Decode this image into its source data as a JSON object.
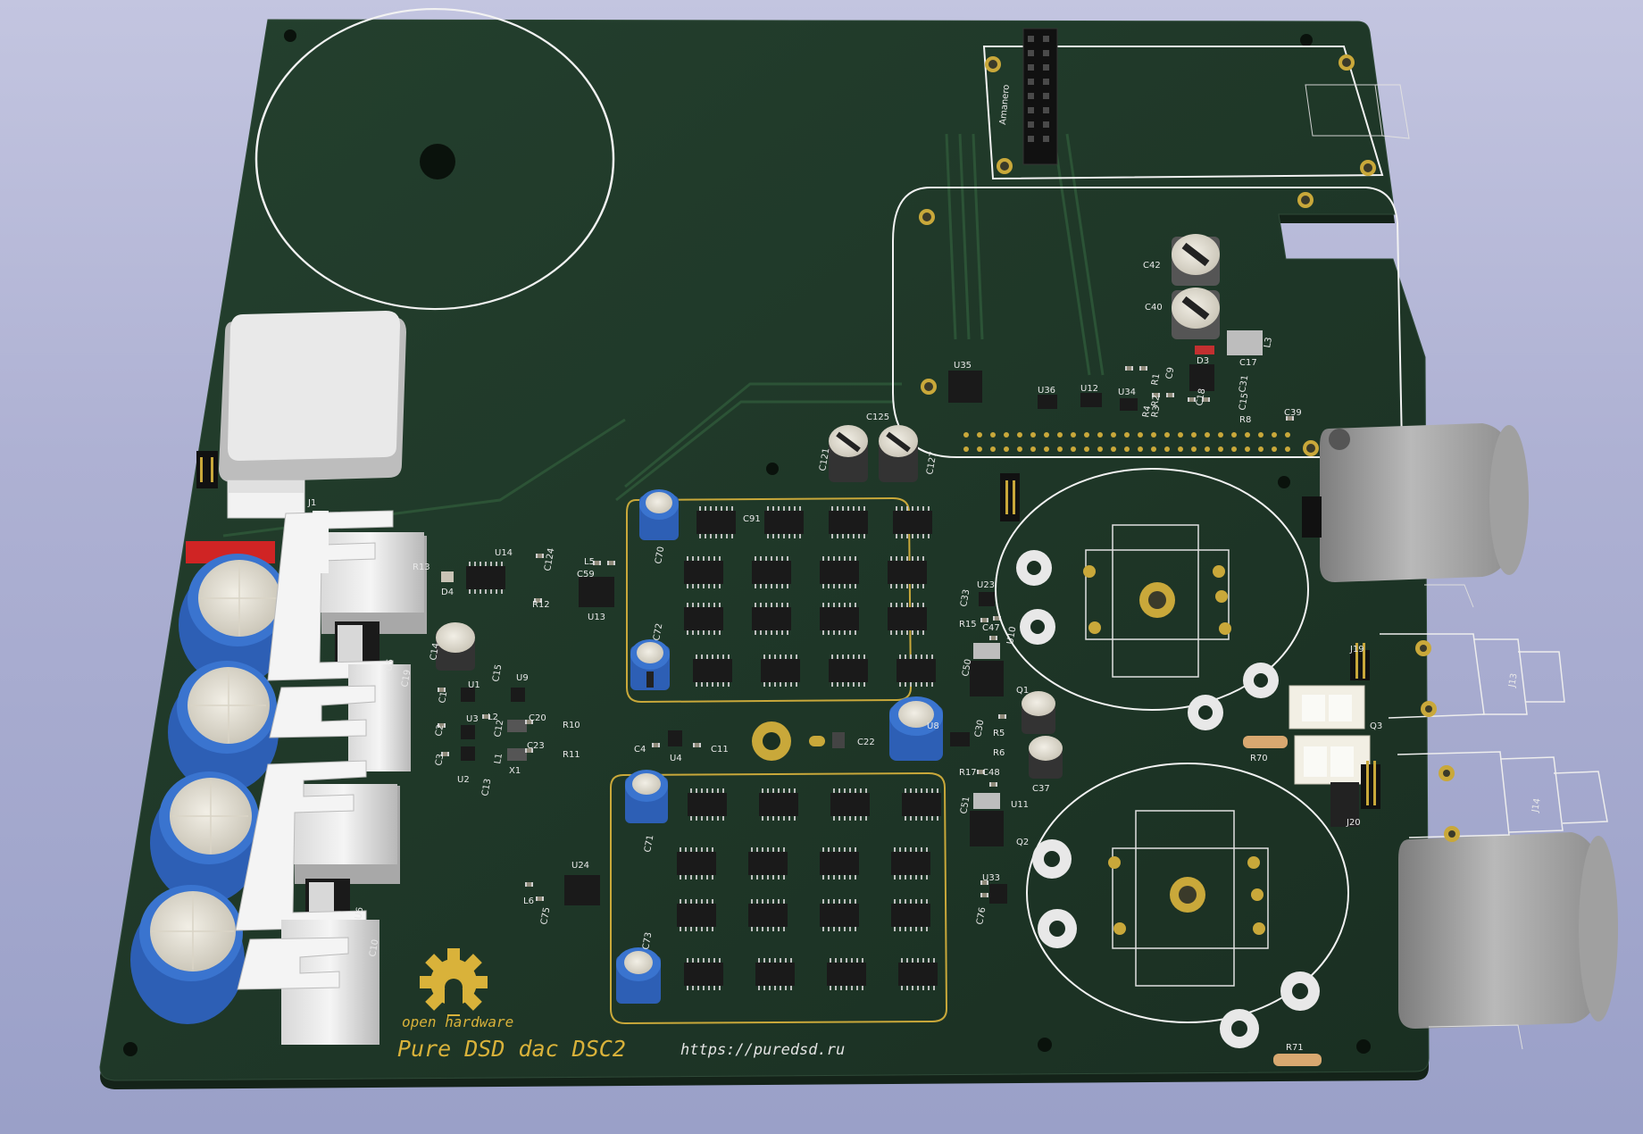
{
  "board": {
    "title": "Pure DSD dac DSC2",
    "url": "https://puredsd.ru",
    "logo_text": "open hardware",
    "header_label": "Amanero",
    "colors": {
      "background": "#aeb1d3",
      "board": "#1e3526",
      "board_edge": "#142319",
      "silkscreen": "#e8e8e8",
      "copper": "#c9a83a",
      "gold_text": "#d9b23a"
    }
  },
  "references": {
    "c42": "C42",
    "c40": "C40",
    "l3": "L3",
    "d3": "D3",
    "c17": "C17",
    "c9": "C9",
    "r1": "R1",
    "r2": "R2",
    "r3": "R3",
    "r4": "R4",
    "r8": "R8",
    "c18": "C18",
    "c31": "C31",
    "c15b": "C15",
    "c39": "C39",
    "u35": "U35",
    "u36": "U36",
    "u12": "U12",
    "u34": "U34",
    "c125": "C125",
    "c121": "C121",
    "c127": "C127",
    "j1": "J1",
    "r13": "R13",
    "d4": "D4",
    "u14": "U14",
    "c124": "C124",
    "r12": "R12",
    "l5": "L5",
    "c59": "C59",
    "u13": "U13",
    "c70": "C70",
    "c91": "C91",
    "c14": "C14",
    "u5": "U5",
    "c19": "C19",
    "u1": "U1",
    "c15": "C15",
    "u9": "U9",
    "c1": "C1",
    "u3": "U3",
    "l2": "L2",
    "c20": "C20",
    "r10": "R10",
    "c2": "C2",
    "c12": "C12",
    "c23": "C23",
    "r11": "R11",
    "c3": "C3",
    "u2": "U2",
    "l1": "L1",
    "x1": "X1",
    "c13": "C13",
    "c4": "C4",
    "u4": "U4",
    "c11": "C11",
    "c22": "C22",
    "u8": "U8",
    "c30": "C30",
    "r5": "R5",
    "r6": "R6",
    "r15": "R15",
    "c47": "C47",
    "u10": "U10",
    "c33": "C33",
    "u23": "U23",
    "c50": "C50",
    "q1": "Q1",
    "r17": "R17",
    "c48": "C48",
    "c51": "C51",
    "u11": "U11",
    "c37": "C37",
    "q2": "Q2",
    "u33": "U33",
    "c76": "C76",
    "c71": "C71",
    "u24": "U24",
    "l6": "L6",
    "c75": "C75",
    "c73": "C73",
    "u6": "U6",
    "c10": "C10",
    "r70": "R70",
    "q3": "Q3",
    "j19": "J19",
    "j13": "J13",
    "j20": "J20",
    "j14": "J14",
    "r71": "R71",
    "c72": "C72"
  }
}
